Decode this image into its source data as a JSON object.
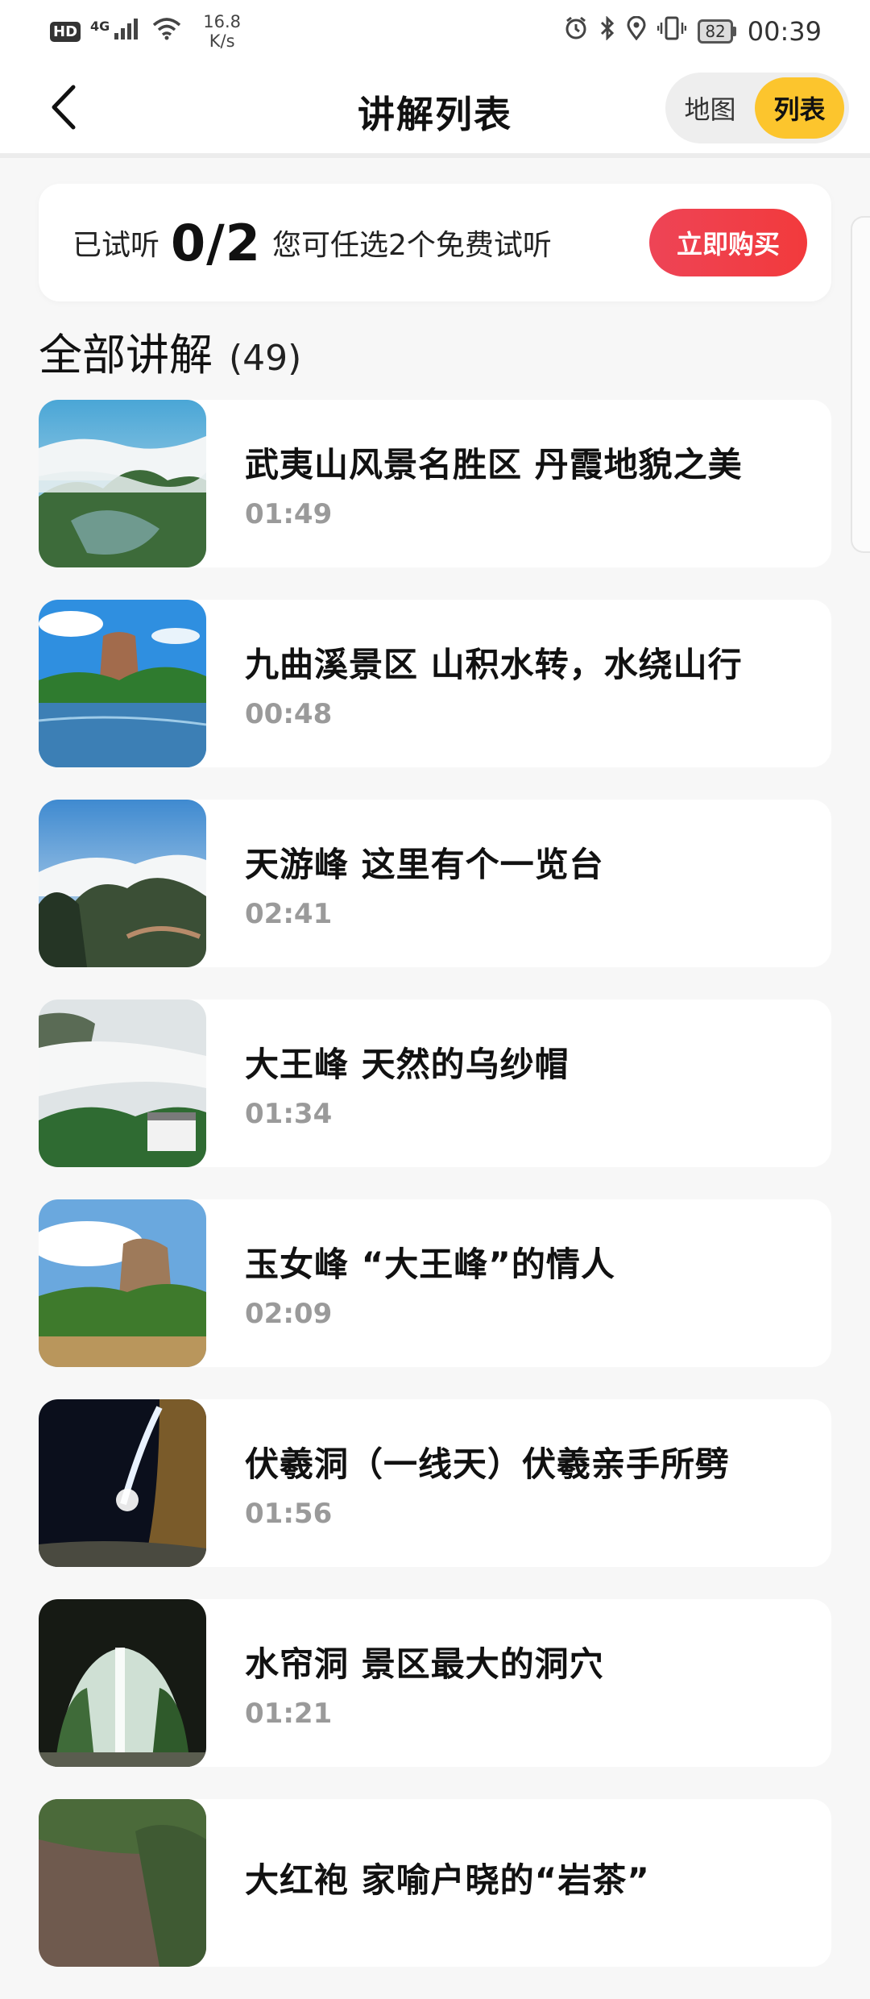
{
  "status_bar": {
    "hd": "HD",
    "network": "4G",
    "speed_value": "16.8",
    "speed_unit": "K/s",
    "battery": "82",
    "time": "00:39"
  },
  "nav": {
    "title": "讲解列表",
    "toggle_map": "地图",
    "toggle_list": "列表"
  },
  "trial": {
    "label": "已试听",
    "count": "0/2",
    "hint": "您可任选2个免费试听",
    "buy_label": "立即购买"
  },
  "section": {
    "title": "全部讲解",
    "count": "(49)"
  },
  "items": [
    {
      "title": "武夷山风景名胜区 丹霞地貌之美",
      "duration": "01:49"
    },
    {
      "title": "九曲溪景区  山积水转，水绕山行",
      "duration": "00:48"
    },
    {
      "title": "天游峰 这里有个一览台",
      "duration": "02:41"
    },
    {
      "title": "大王峰 天然的乌纱帽",
      "duration": "01:34"
    },
    {
      "title": "玉女峰 “大王峰”的情人",
      "duration": "02:09"
    },
    {
      "title": "伏羲洞（一线天）伏羲亲手所劈",
      "duration": "01:56"
    },
    {
      "title": "水帘洞 景区最大的洞穴",
      "duration": "01:21"
    },
    {
      "title": "大红袍 家喻户晓的“岩茶”",
      "duration": ""
    }
  ],
  "colors": {
    "accent_yellow": "#fcc52d",
    "buy_red": "#f23a3c",
    "duration_gray": "#9a9a9a"
  }
}
